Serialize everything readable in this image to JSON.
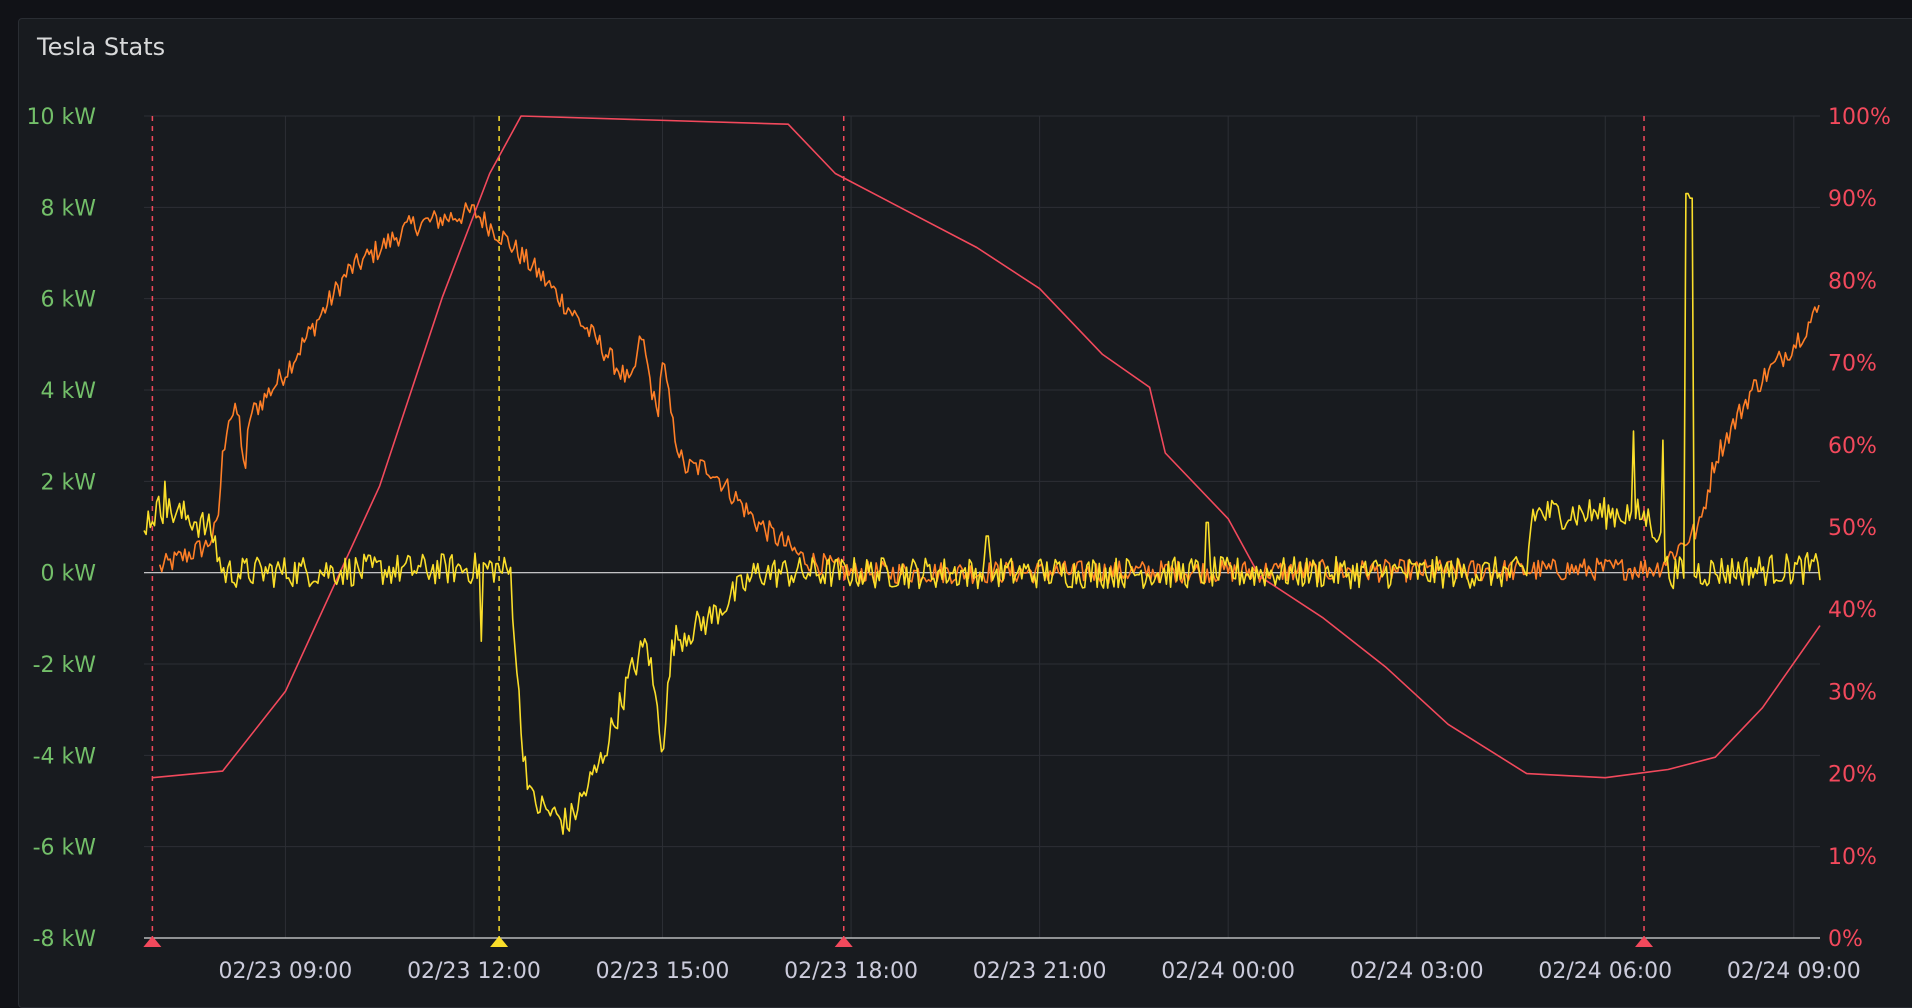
{
  "panel": {
    "title": "Tesla Stats"
  },
  "colors": {
    "background": "#181b1f",
    "grid": "#2c2f35",
    "zero_line": "#d8d9da",
    "left_axis": "#73bf69",
    "right_axis": "#f2495c",
    "x_axis": "#ccccdc",
    "annotation_red": "#f2495c",
    "annotation_yellow": "#fade2a"
  },
  "chart_data": {
    "type": "line",
    "title": "Tesla Stats",
    "x_axis": {
      "type": "time",
      "range": [
        "02/23 06:45",
        "02/24 09:25"
      ],
      "ticks": [
        "02/23 09:00",
        "02/23 12:00",
        "02/23 15:00",
        "02/23 18:00",
        "02/23 21:00",
        "02/24 00:00",
        "02/24 03:00",
        "02/24 06:00",
        "02/24 09:00"
      ]
    },
    "y_left": {
      "unit": "kW",
      "range": [
        -8,
        10
      ],
      "ticks": [
        "10 kW",
        "8 kW",
        "6 kW",
        "4 kW",
        "2 kW",
        "0 kW",
        "-2 kW",
        "-4 kW",
        "-6 kW",
        "-8 kW"
      ],
      "values": [
        10,
        8,
        6,
        4,
        2,
        0,
        -2,
        -4,
        -6,
        -8
      ]
    },
    "y_right": {
      "unit": "%",
      "range": [
        0,
        100
      ],
      "ticks": [
        "100%",
        "90%",
        "80%",
        "70%",
        "60%",
        "50%",
        "40%",
        "30%",
        "20%",
        "10%",
        "0%"
      ],
      "values": [
        100,
        90,
        80,
        70,
        60,
        50,
        40,
        30,
        20,
        10,
        0
      ]
    },
    "grid": true,
    "legend": "none",
    "annotations": [
      {
        "time": "02/23 06:53",
        "color": "red"
      },
      {
        "time": "02/23 12:24",
        "color": "yellow"
      },
      {
        "time": "02/23 17:53",
        "color": "red"
      },
      {
        "time": "02/24 06:37",
        "color": "red"
      }
    ],
    "series": [
      {
        "color": "#ff7f27",
        "axis": "left",
        "noise": 0.25,
        "points": [
          [
            "02/23 07:00",
            0.1
          ],
          [
            "02/23 07:45",
            0.6
          ],
          [
            "02/23 07:55",
            1.0
          ],
          [
            "02/23 08:00",
            2.5
          ],
          [
            "02/23 08:05",
            3.4
          ],
          [
            "02/23 08:15",
            3.5
          ],
          [
            "02/23 08:22",
            2.1
          ],
          [
            "02/23 08:25",
            3.4
          ],
          [
            "02/23 09:00",
            4.4
          ],
          [
            "02/23 10:00",
            6.6
          ],
          [
            "02/23 11:00",
            7.6
          ],
          [
            "02/23 12:00",
            7.9
          ],
          [
            "02/23 12:30",
            7.3
          ],
          [
            "02/23 13:00",
            6.6
          ],
          [
            "02/23 14:00",
            5.0
          ],
          [
            "02/23 14:30",
            4.1
          ],
          [
            "02/23 14:40",
            5.2
          ],
          [
            "02/23 14:55",
            3.4
          ],
          [
            "02/23 15:00",
            4.7
          ],
          [
            "02/23 15:10",
            3.2
          ],
          [
            "02/23 15:20",
            2.3
          ],
          [
            "02/23 15:45",
            2.3
          ],
          [
            "02/23 16:30",
            1.1
          ],
          [
            "02/23 17:15",
            0.3
          ],
          [
            "02/23 18:00",
            0.0
          ],
          [
            "02/24 04:45",
            0.05
          ],
          [
            "02/24 06:50",
            0.1
          ],
          [
            "02/24 07:30",
            1.0
          ],
          [
            "02/24 07:45",
            2.5
          ],
          [
            "02/24 08:20",
            4.0
          ],
          [
            "02/24 09:00",
            5.0
          ],
          [
            "02/24 09:25",
            5.8
          ]
        ]
      },
      {
        "color": "#f2495c",
        "axis": "right",
        "noise": 0,
        "points": [
          [
            "02/23 06:53",
            19.5
          ],
          [
            "02/23 08:00",
            20.3
          ],
          [
            "02/23 09:00",
            30
          ],
          [
            "02/23 10:30",
            55
          ],
          [
            "02/23 11:30",
            78
          ],
          [
            "02/23 12:15",
            93
          ],
          [
            "02/23 12:45",
            100
          ],
          [
            "02/23 17:00",
            99
          ],
          [
            "02/23 17:45",
            93
          ],
          [
            "02/23 18:30",
            90
          ],
          [
            "02/23 20:00",
            84
          ],
          [
            "02/23 21:00",
            79
          ],
          [
            "02/23 22:00",
            71
          ],
          [
            "02/23 22:45",
            67
          ],
          [
            "02/23 23:00",
            59
          ],
          [
            "02/24 00:00",
            51
          ],
          [
            "02/24 00:30",
            44
          ],
          [
            "02/24 01:30",
            39
          ],
          [
            "02/24 02:30",
            33
          ],
          [
            "02/24 03:30",
            26
          ],
          [
            "02/24 04:45",
            20
          ],
          [
            "02/24 06:00",
            19.5
          ],
          [
            "02/24 07:00",
            20.5
          ],
          [
            "02/24 07:45",
            22
          ],
          [
            "02/24 08:30",
            28
          ],
          [
            "02/24 09:25",
            38
          ]
        ]
      },
      {
        "color": "#fade2a",
        "axis": "left",
        "noise": 0.35,
        "points": [
          [
            "02/23 06:45",
            1.1
          ],
          [
            "02/23 07:00",
            1.4
          ],
          [
            "02/23 07:30",
            1.2
          ],
          [
            "02/23 07:50",
            0.9
          ],
          [
            "02/23 08:00",
            0.0
          ],
          [
            "02/23 12:20",
            0.1
          ],
          [
            "02/23 12:35",
            0.0
          ],
          [
            "02/23 12:45",
            -3.5
          ],
          [
            "02/23 12:55",
            -5.0
          ],
          [
            "02/23 13:30",
            -5.5
          ],
          [
            "02/23 14:00",
            -4.2
          ],
          [
            "02/23 14:30",
            -2.2
          ],
          [
            "02/23 14:45",
            -1.5
          ],
          [
            "02/23 15:00",
            -3.8
          ],
          [
            "02/23 15:10",
            -1.5
          ],
          [
            "02/23 15:45",
            -1.0
          ],
          [
            "02/23 16:30",
            0.0
          ],
          [
            "02/24 04:45",
            0.0
          ],
          [
            "02/24 04:50",
            1.3
          ],
          [
            "02/24 06:30",
            1.3
          ],
          [
            "02/24 06:40",
            1.2
          ],
          [
            "02/24 06:50",
            0.9
          ],
          [
            "02/24 07:00",
            0.0
          ],
          [
            "02/24 09:25",
            0.1
          ]
        ],
        "spikes": [
          [
            "02/23 07:05",
            2.0
          ],
          [
            "02/23 12:07",
            -1.5
          ],
          [
            "02/23 20:10",
            0.8
          ],
          [
            "02/23 23:40",
            1.1
          ],
          [
            "02/24 06:27",
            3.1
          ],
          [
            "02/24 06:55",
            2.9
          ],
          [
            "02/24 07:18",
            8.3
          ],
          [
            "02/24 07:22",
            8.2
          ]
        ]
      }
    ]
  }
}
